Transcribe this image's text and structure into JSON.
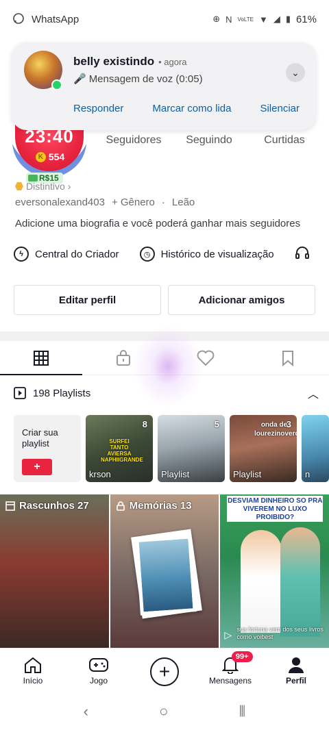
{
  "status_bar": {
    "app_name": "WhatsApp",
    "battery": "61%"
  },
  "notification": {
    "sender": "belly existindo",
    "time": "• agora",
    "message": "Mensagem de voz (0:05)",
    "actions": [
      "Responder",
      "Marcar como lida",
      "Silenciar"
    ]
  },
  "profile": {
    "live_time": "23:40",
    "coins": "554",
    "money": "R$15",
    "stats_labels": [
      "Seguidores",
      "Seguindo",
      "Curtidas"
    ],
    "badge_label": "Distintivo",
    "username": "eversonalexand403",
    "gender": "+ Gênero",
    "zodiac": "Leão",
    "bio": "Adicione uma biografia e você poderá ganhar mais seguidores",
    "links": [
      "Central do Criador",
      "Histórico de visualização"
    ],
    "edit_button": "Editar perfil",
    "add_friends_button": "Adicionar amigos"
  },
  "playlists": {
    "header": "198 Playlists",
    "create_label": "Criar sua playlist",
    "create_plus": "+",
    "cards": [
      {
        "name": "krson",
        "count": "8",
        "caption": "SURFEI TANTO AVIERSA NAPHIIGRANDE"
      },
      {
        "name": "Playlist",
        "count": "5",
        "caption": ""
      },
      {
        "name": "Playlist",
        "count": "3",
        "caption": "onda de lourezinoverda"
      },
      {
        "name": "n",
        "count": "",
        "caption": ""
      }
    ]
  },
  "grid": [
    {
      "label": "Rascunhos 27",
      "caption": ""
    },
    {
      "label": "Memórias 13",
      "caption": ""
    },
    {
      "label": "",
      "banner": "DESVIAM DINHEIRO SO PRA VIVEREM NO LUXO PROIBIDO?",
      "caption": "sua fortuna vem dos seus livros como voibest"
    }
  ],
  "bottom_nav": {
    "items": [
      "Início",
      "Jogo",
      "",
      "Mensagens",
      "Perfil"
    ],
    "messages_badge": "99+"
  }
}
